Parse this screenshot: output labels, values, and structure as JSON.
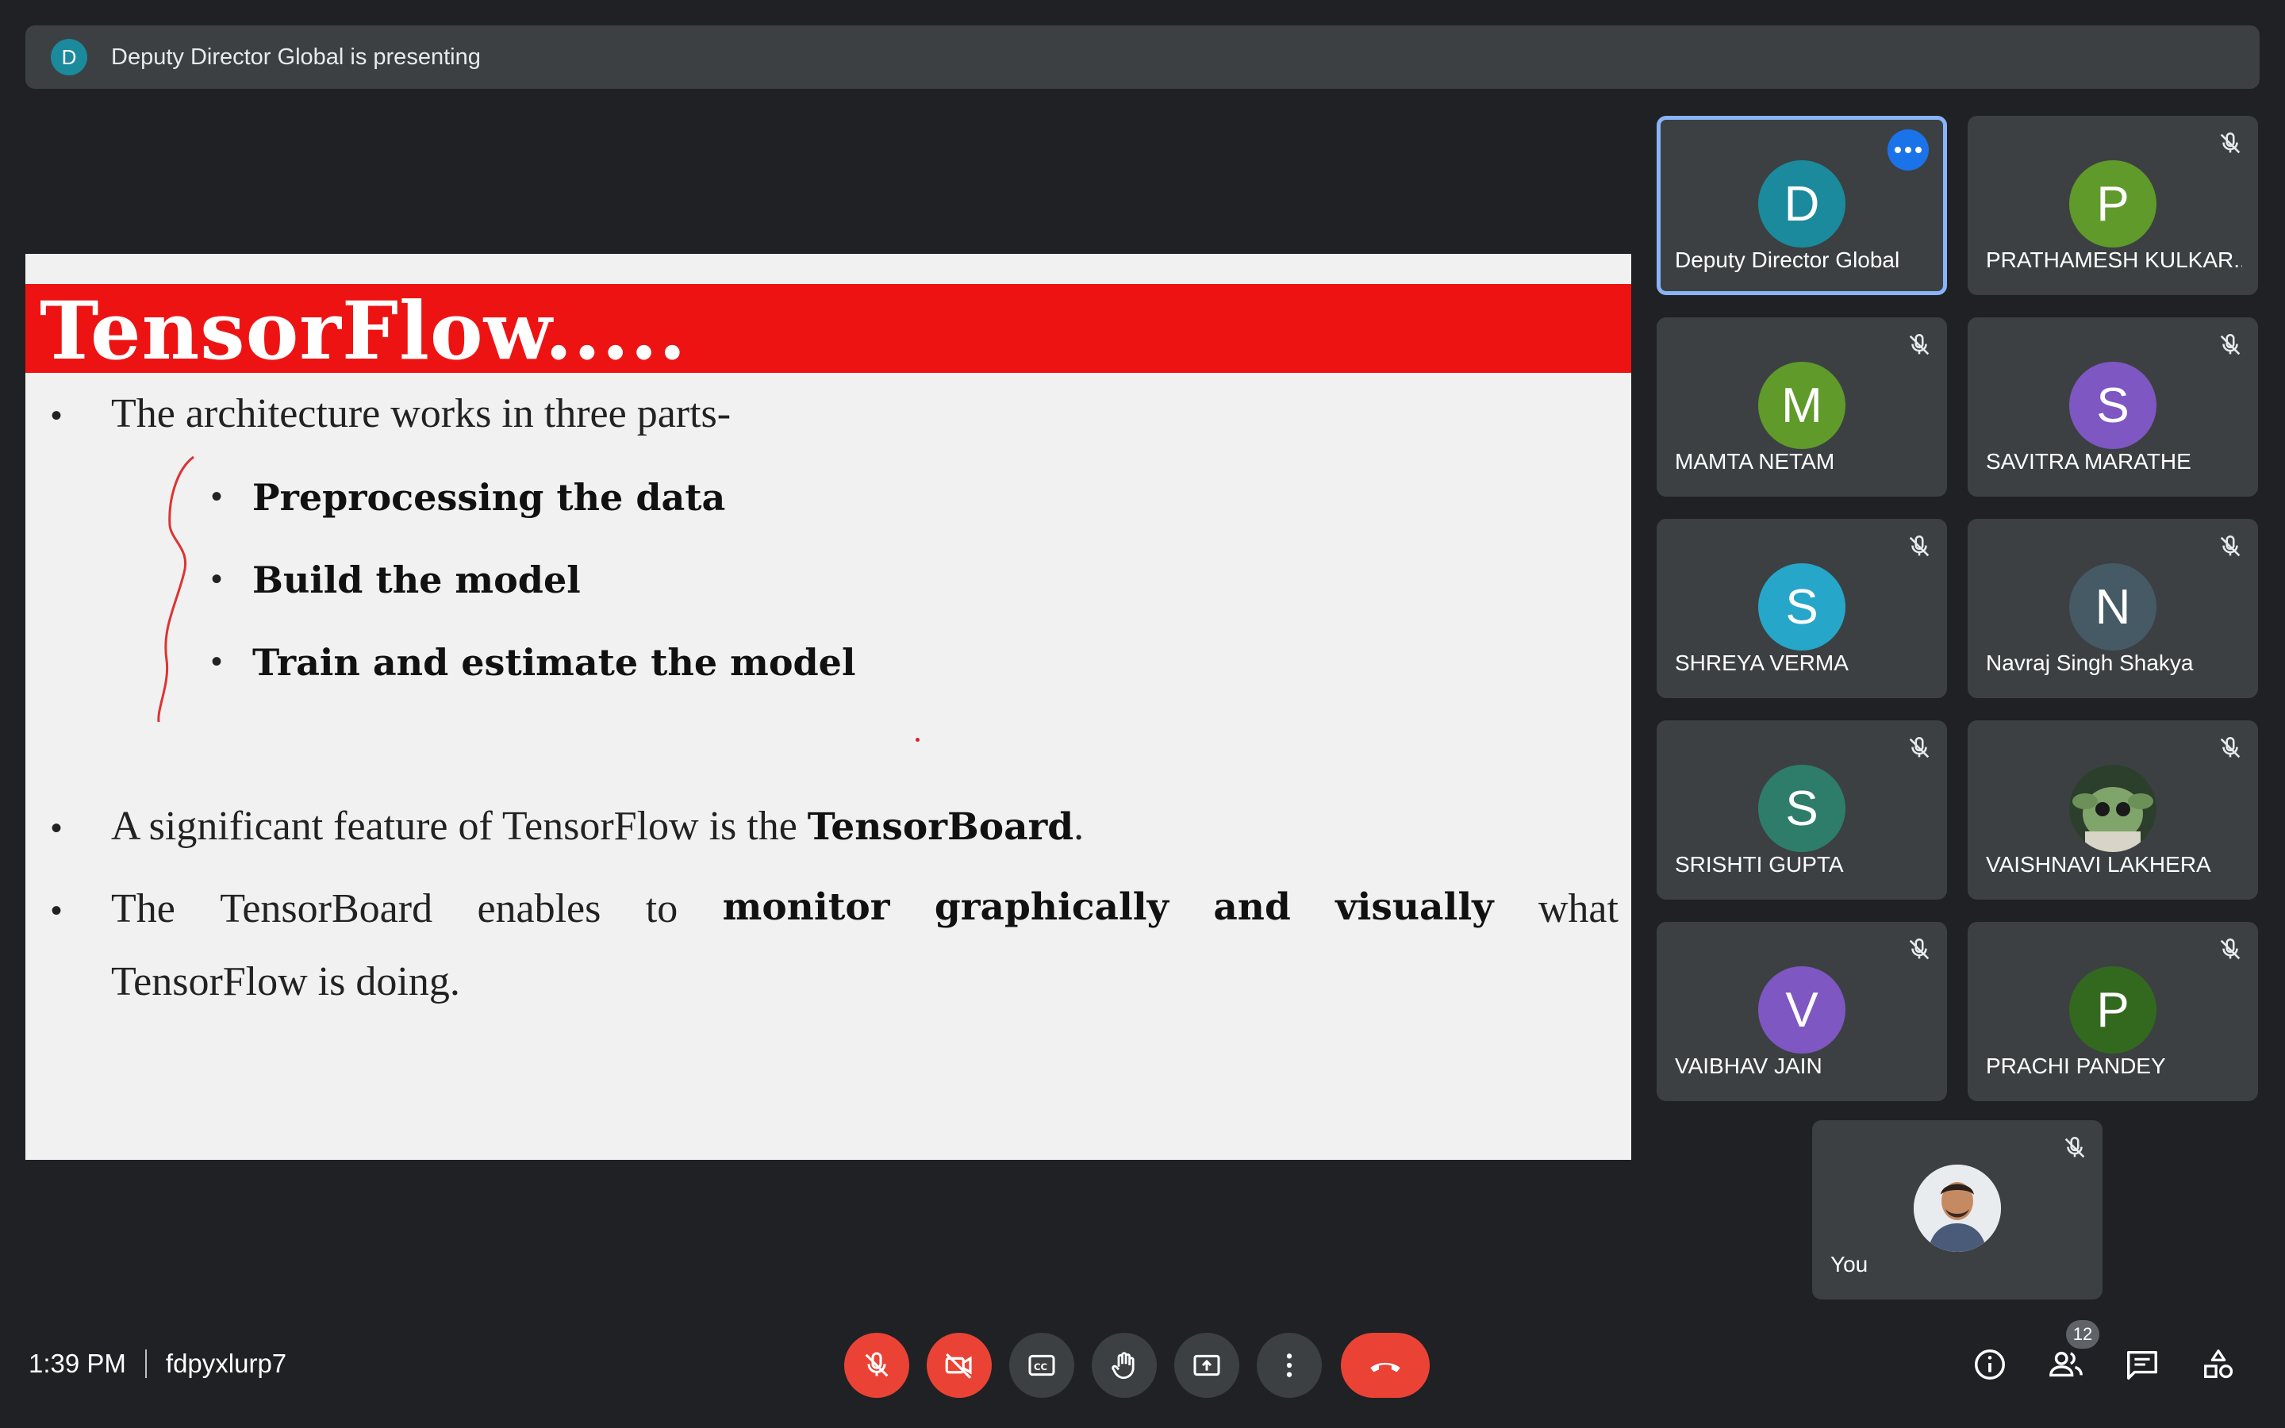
{
  "banner": {
    "avatar_letter": "D",
    "text": "Deputy Director Global is presenting"
  },
  "slide": {
    "title": "TensorFlow.....",
    "line1": "The architecture works in three parts-",
    "sub1": "Preprocessing the data",
    "sub2": "Build the model",
    "sub3": "Train and estimate the model",
    "line2_pre": "A significant feature of TensorFlow is the ",
    "line2_bold": "TensorBoard",
    "line2_post": ".",
    "line3": [
      "The",
      "TensorBoard",
      "enables",
      "to"
    ],
    "line3_bold": [
      "monitor",
      "graphically",
      "and",
      "visually"
    ],
    "line3_end": "what",
    "line4": "TensorFlow is doing."
  },
  "participants": [
    {
      "letter": "D",
      "name": "Deputy Director Global",
      "color": "#1a8a9c",
      "active": true,
      "muted": false
    },
    {
      "letter": "P",
      "name": "PRATHAMESH KULKAR...",
      "color": "#5f9a2a",
      "muted": true
    },
    {
      "letter": "M",
      "name": "MAMTA NETAM",
      "color": "#5f9a2a",
      "muted": true
    },
    {
      "letter": "S",
      "name": "SAVITRA MARATHE",
      "color": "#7e57c2",
      "muted": true
    },
    {
      "letter": "S",
      "name": "SHREYA VERMA",
      "color": "#26a6c9",
      "muted": true
    },
    {
      "letter": "N",
      "name": "Navraj Singh Shakya",
      "color": "#455a64",
      "muted": true
    },
    {
      "letter": "S",
      "name": "SRISHTI GUPTA",
      "color": "#2e7d6b",
      "muted": true
    },
    {
      "letter": "",
      "name": "VAISHNAVI LAKHERA",
      "color": "#3b5d3a",
      "muted": true
    },
    {
      "letter": "V",
      "name": "VAIBHAV JAIN",
      "color": "#7e57c2",
      "muted": true
    },
    {
      "letter": "P",
      "name": "PRACHI PANDEY",
      "color": "#33691e",
      "muted": true
    },
    {
      "letter": "",
      "name": "You",
      "color": "#c9ccd1",
      "muted": true
    }
  ],
  "footer": {
    "time": "1:39 PM",
    "meeting_code": "fdpyxlurp7",
    "people_count": "12"
  },
  "colors": {
    "end_call": "#ea4335",
    "active_border": "#8ab4f8",
    "accent": "#1a73e8"
  }
}
